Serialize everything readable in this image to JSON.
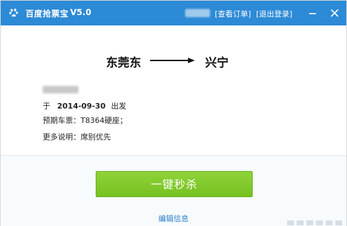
{
  "titlebar": {
    "title": "百度抢票宝",
    "version": "V5.0",
    "view_orders": "[查看订单]",
    "logout": "[退出登录]"
  },
  "route": {
    "from": "东莞东",
    "to": "兴宁"
  },
  "info": {
    "date_prefix": "于",
    "date": "2014-09-30",
    "date_suffix": "出发",
    "ticket": "预期车票：T8364硬座；",
    "notes": "更多说明：席别优先"
  },
  "actions": {
    "go_button": "一键秒杀",
    "edit": "编辑信息"
  },
  "icons": {
    "app": "baidu-paw-icon",
    "minimize": "minimize-icon",
    "close": "close-icon",
    "arrow": "arrow-right-icon"
  },
  "colors": {
    "titlebar": "#2c8ad6",
    "button": "#7ec428",
    "link": "#2c7fc9"
  }
}
